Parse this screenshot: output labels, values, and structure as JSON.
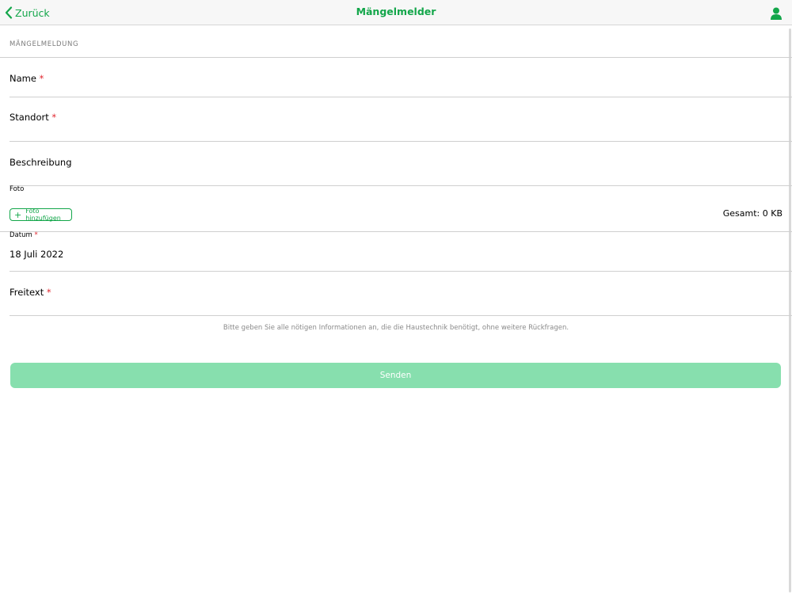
{
  "navbar": {
    "back_label": "Zurück",
    "title": "Mängelmelder"
  },
  "form": {
    "section_header": "MÄNGELMELDUNG",
    "name_label": "Name",
    "location_label": "Standort",
    "description_label": "Beschreibung",
    "photo_label": "Foto",
    "add_photo_label": "Foto hinzufügen",
    "total_size": "Gesamt: 0 KB",
    "date_label": "Datum",
    "date_value": "18 Juli 2022",
    "freetext_label": "Freitext",
    "required_marker": "*",
    "hint": "Bitte geben Sie alle nötigen Informationen an, die die Haustechnik benötigt, ohne weitere Rückfragen.",
    "submit_label": "Senden"
  },
  "colors": {
    "accent": "#13a64a",
    "submit_disabled": "#87dfae",
    "required": "#e0262e"
  },
  "icons": {
    "back": "chevron-left-icon",
    "profile": "person-icon",
    "add_photo": "plus-icon"
  }
}
